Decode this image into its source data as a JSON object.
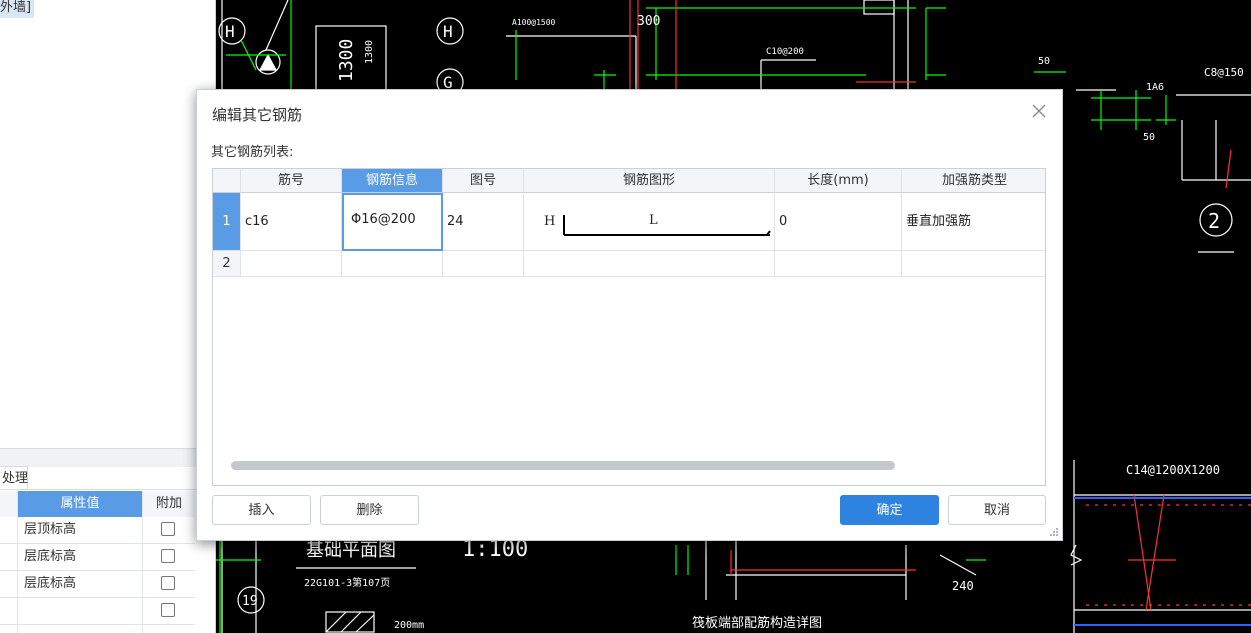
{
  "left_panel": {
    "top_label": "外墙]",
    "tab_label": "钢筋处理",
    "prop_headers": {
      "value": "属性值",
      "extra": "附加"
    },
    "rows": [
      {
        "value": "层顶标高"
      },
      {
        "value": "层底标高"
      },
      {
        "value": "层底标高"
      },
      {
        "value": ""
      }
    ]
  },
  "cad": {
    "axis_labels": [
      "H",
      "G",
      "19"
    ],
    "dim_1300": "1300",
    "dim_300": "300",
    "dim_50": "50",
    "dim_50b": "50",
    "dim_240": "240",
    "text_a100": "A100@1500",
    "text_c10": "C10@200",
    "text_c8": "C8@150",
    "text_1a6": "1A6",
    "text_c14": "C14@1200X1200",
    "text_scale": "1:100",
    "text_plan": "基础平面图",
    "text_22g": "22G101-3第107页",
    "text_200mm": "200mm",
    "text_detail": "筏板端部配筋构造详图",
    "circle_2": "2"
  },
  "dialog": {
    "title": "编辑其它钢筋",
    "list_label": "其它钢筋列表:",
    "columns": [
      "筋号",
      "钢筋信息",
      "图号",
      "钢筋图形",
      "长度(mm)",
      "加强筋类型"
    ],
    "rows": [
      {
        "num": "1",
        "bar_no": "c16",
        "info": "Φ16@200",
        "fig_no": "24",
        "shape_h": "H",
        "shape_l": "L",
        "length": "0",
        "type": "垂直加强筋"
      },
      {
        "num": "2",
        "bar_no": "",
        "info": "",
        "fig_no": "",
        "shape_h": "",
        "shape_l": "",
        "length": "",
        "type": ""
      }
    ],
    "buttons": {
      "insert": "插入",
      "delete": "删除",
      "ok": "确定",
      "cancel": "取消"
    }
  }
}
